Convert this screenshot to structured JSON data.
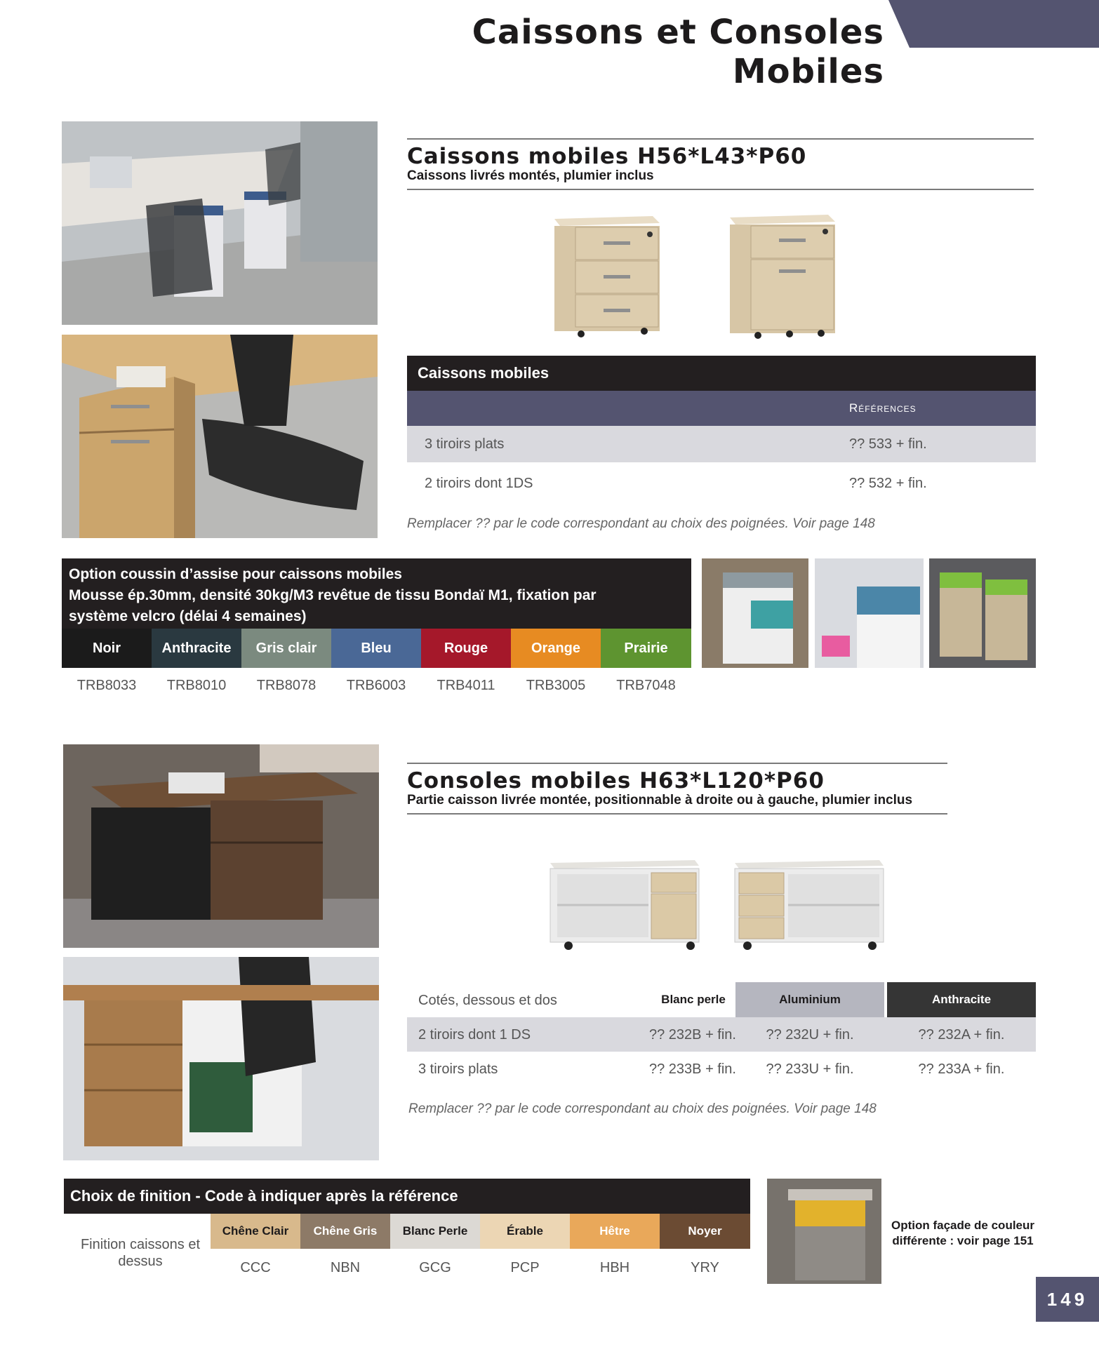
{
  "page": {
    "title": "Caissons et Consoles Mobiles",
    "page_number": "149"
  },
  "caissons": {
    "title": "Caissons mobiles H56*L43*P60",
    "subtitle": "Caissons livrés montés, plumier inclus",
    "table_title": "Caissons mobiles",
    "col_header": "Références",
    "rows": [
      {
        "label": "3 tiroirs plats",
        "ref": "?? 533 + fin."
      },
      {
        "label": "2 tiroirs dont 1DS",
        "ref": "?? 532 + fin."
      }
    ],
    "note": "Remplacer ?? par le code correspondant au choix des poignées. Voir page 148"
  },
  "cushion": {
    "title_line1": "Option coussin d’assise pour caissons mobiles",
    "title_line2": "Mousse ép.30mm, densité 30kg/M3 revêtue de tissu Bondaï M1, fixation par",
    "title_line3": "système velcro (délai 4 semaines)",
    "colors": [
      {
        "name": "Noir",
        "code": "TRB8033",
        "hex": "#1b1b1b"
      },
      {
        "name": "Anthracite",
        "code": "TRB8010",
        "hex": "#2a3940"
      },
      {
        "name": "Gris clair",
        "code": "TRB8078",
        "hex": "#7b8a7f"
      },
      {
        "name": "Bleu",
        "code": "TRB6003",
        "hex": "#4a6896"
      },
      {
        "name": "Rouge",
        "code": "TRB4011",
        "hex": "#a5182a"
      },
      {
        "name": "Orange",
        "code": "TRB3005",
        "hex": "#e78b22"
      },
      {
        "name": "Prairie",
        "code": "TRB7048",
        "hex": "#5e9430"
      }
    ]
  },
  "consoles": {
    "title": "Consoles mobiles H63*L120*P60",
    "subtitle": "Partie caisson livrée montée, positionnable à droite ou à gauche, plumier inclus",
    "header_label": "Cotés, dessous et dos",
    "finishes": [
      {
        "name": "Blanc perle",
        "bg": "#ffffff",
        "fg": "#1d1b1c"
      },
      {
        "name": "Aluminium",
        "bg": "#b5b6bf",
        "fg": "#1d1b1c"
      },
      {
        "name": "Anthracite",
        "bg": "#353535",
        "fg": "#ffffff"
      }
    ],
    "rows": [
      {
        "label": "2 tiroirs dont 1 DS",
        "values": [
          "?? 232B + fin.",
          "?? 232U + fin.",
          "?? 232A + fin."
        ]
      },
      {
        "label": "3 tiroirs plats",
        "values": [
          "?? 233B + fin.",
          "?? 233U + fin.",
          "?? 233A + fin."
        ]
      }
    ],
    "note": "Remplacer ?? par le code correspondant au choix des poignées. Voir page 148"
  },
  "finition": {
    "title": "Choix de finition - Code à indiquer après la référence",
    "row_label": "Finition caissons et dessus",
    "woods": [
      {
        "name": "Chêne Clair",
        "code": "CCC",
        "hex": "#d8b98c",
        "fg": "#1d1b1c"
      },
      {
        "name": "Chêne Gris",
        "code": "NBN",
        "hex": "#8d7a67",
        "fg": "#ffffff"
      },
      {
        "name": "Blanc Perle",
        "code": "GCG",
        "hex": "#dcd9d4",
        "fg": "#1d1b1c"
      },
      {
        "name": "Érable",
        "code": "PCP",
        "hex": "#ecd6b4",
        "fg": "#1d1b1c"
      },
      {
        "name": "Hêtre",
        "code": "HBH",
        "hex": "#e9a85a",
        "fg": "#ffffff"
      },
      {
        "name": "Noyer",
        "code": "YRY",
        "hex": "#6b4b33",
        "fg": "#ffffff"
      }
    ],
    "facade_note": "Option façade de couleur différente : voir page 151"
  }
}
